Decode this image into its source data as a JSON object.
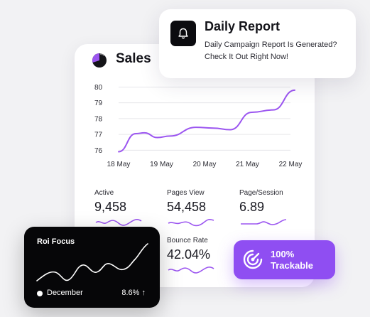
{
  "sales": {
    "title": "Sales",
    "chart_data": {
      "type": "line",
      "x": [
        "18 May",
        "19 May",
        "20 May",
        "21 May",
        "22 May"
      ],
      "y_ticks": [
        76,
        77,
        78,
        79,
        80
      ],
      "ylim": [
        75.7,
        80.2
      ],
      "points": [
        [
          0,
          75.9
        ],
        [
          0.4,
          77.05
        ],
        [
          0.6,
          77.1
        ],
        [
          0.9,
          76.8
        ],
        [
          1.2,
          76.9
        ],
        [
          1.8,
          77.45
        ],
        [
          2.2,
          77.4
        ],
        [
          2.6,
          77.3
        ],
        [
          3.1,
          78.4
        ],
        [
          3.6,
          78.55
        ],
        [
          4.1,
          79.8
        ]
      ],
      "color": "#9b55f0",
      "grid": true
    },
    "stats": [
      {
        "label": "Active",
        "value": "9,458"
      },
      {
        "label": "Pages View",
        "value": "54,458"
      },
      {
        "label": "Page/Session",
        "value": "6.89"
      },
      {
        "label": "Bounce Rate",
        "value": "42.04%"
      }
    ]
  },
  "notification": {
    "title": "Daily Report",
    "message": "Daily Campaign Report Is Generated? Check It Out Right Now!"
  },
  "roi": {
    "title": "Roi Focus",
    "month": "December",
    "percent": "8.6% ↑"
  },
  "trackable": {
    "line1": "100%",
    "line2": "Trackable"
  },
  "colors": {
    "accent": "#9b55f0",
    "badge": "#8f4ef2",
    "dark": "#060608"
  }
}
